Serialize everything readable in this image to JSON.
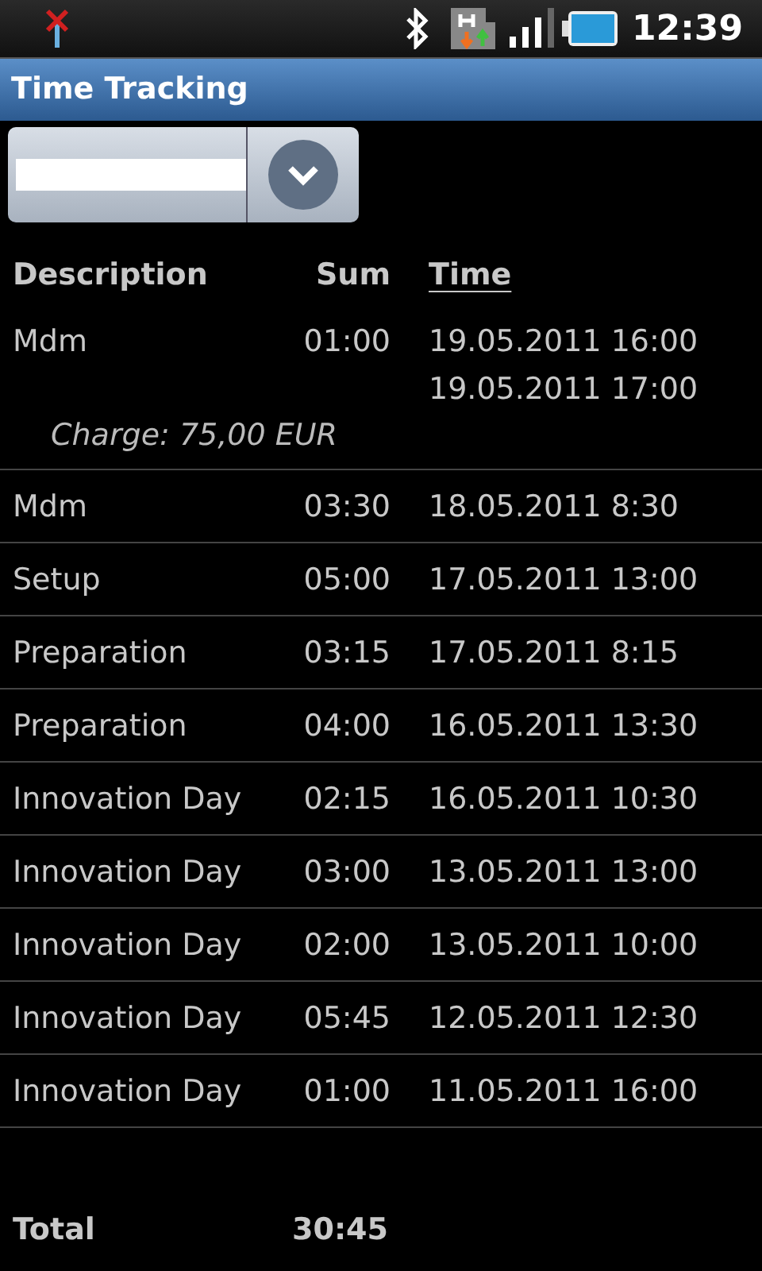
{
  "status_bar": {
    "time": "12:39"
  },
  "window": {
    "title": "Time Tracking"
  },
  "columns": [
    {
      "label": "Description",
      "sorted": false
    },
    {
      "label": "Sum",
      "sorted": false
    },
    {
      "label": "Time",
      "sorted": true
    }
  ],
  "rows": [
    {
      "description": "Mdm",
      "sum": "01:00",
      "times": [
        "19.05.2011 16:00",
        "19.05.2011 17:00"
      ],
      "charge": "Charge: 75,00 EUR"
    },
    {
      "description": "Mdm",
      "sum": "03:30",
      "times": [
        "18.05.2011 8:30"
      ]
    },
    {
      "description": "Setup",
      "sum": "05:00",
      "times": [
        "17.05.2011 13:00"
      ]
    },
    {
      "description": "Preparation",
      "sum": "03:15",
      "times": [
        "17.05.2011 8:15"
      ]
    },
    {
      "description": "Preparation",
      "sum": "04:00",
      "times": [
        "16.05.2011 13:30"
      ]
    },
    {
      "description": "Innovation Day",
      "sum": "02:15",
      "times": [
        "16.05.2011 10:30"
      ]
    },
    {
      "description": "Innovation Day",
      "sum": "03:00",
      "times": [
        "13.05.2011 13:00"
      ]
    },
    {
      "description": "Innovation Day",
      "sum": "02:00",
      "times": [
        "13.05.2011 10:00"
      ]
    },
    {
      "description": "Innovation Day",
      "sum": "05:45",
      "times": [
        "12.05.2011 12:30"
      ]
    },
    {
      "description": "Innovation Day",
      "sum": "01:00",
      "times": [
        "11.05.2011 16:00"
      ]
    }
  ],
  "total": {
    "label": "Total",
    "sum": "30:45"
  }
}
